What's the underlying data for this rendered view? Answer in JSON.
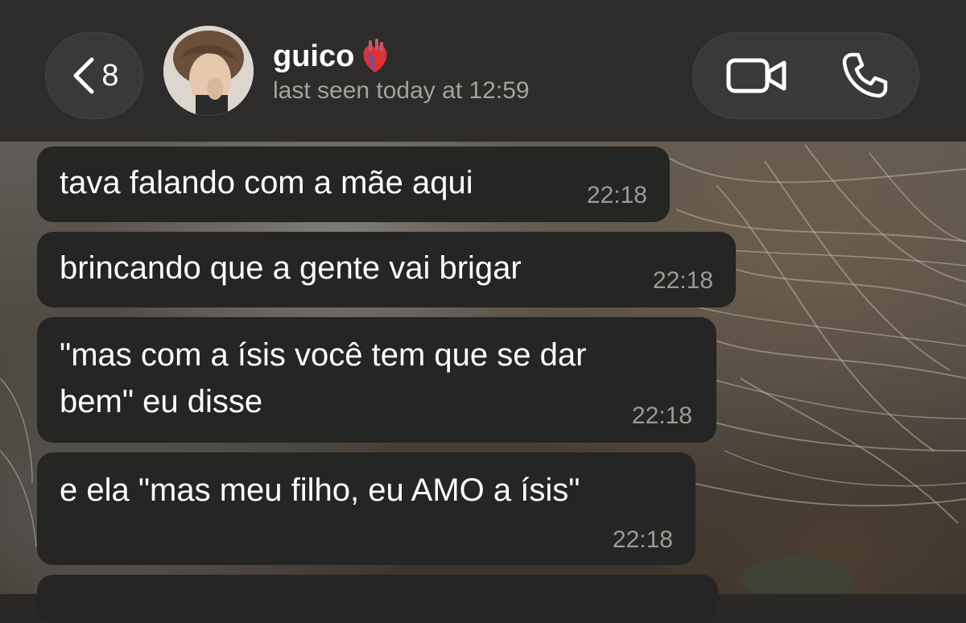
{
  "header": {
    "back_count": "8",
    "contact_name": "guico",
    "contact_emoji": "anatomical-heart",
    "last_seen": "last seen today at 12:59"
  },
  "messages": [
    {
      "lines": [
        "tava falando com a mãe aqui"
      ],
      "time": "22:18"
    },
    {
      "lines": [
        "brincando que a gente vai brigar"
      ],
      "time": "22:18"
    },
    {
      "lines": [
        "\"mas com a ísis você tem que se dar",
        "bem\" eu disse"
      ],
      "time": "22:18"
    },
    {
      "lines": [
        "e ela \"mas meu filho, eu AMO a ísis\""
      ],
      "time": "22:18"
    }
  ],
  "colors": {
    "header_bg": "#2d2c2a",
    "bubble_bg": "#252524",
    "time_text": "#9c9a96",
    "status_text": "#a4a29e"
  }
}
